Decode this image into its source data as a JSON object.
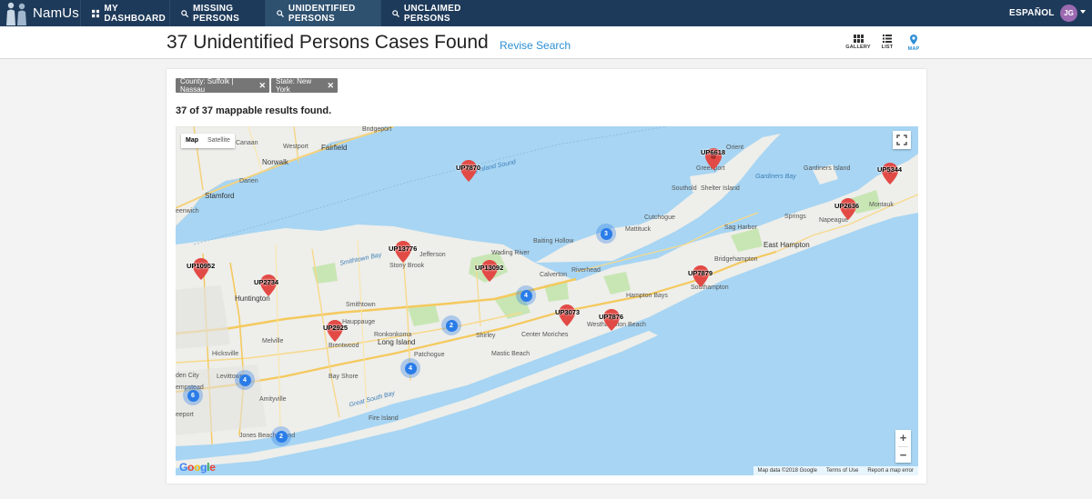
{
  "nav": {
    "logo": "NamUs",
    "items": [
      {
        "label": "MY DASHBOARD",
        "icon": "dashboard-grid-icon"
      },
      {
        "label": "MISSING PERSONS",
        "icon": "search-icon"
      },
      {
        "label": "UNIDENTIFIED PERSONS",
        "icon": "search-icon",
        "active": true
      },
      {
        "label": "UNCLAIMED PERSONS",
        "icon": "search-icon"
      }
    ],
    "language": "ESPAÑOL",
    "avatar_initials": "JG"
  },
  "header": {
    "title": "37 Unidentified Persons Cases Found",
    "revise_label": "Revise Search",
    "views": [
      {
        "label": "GALLERY",
        "icon": "gallery-grid-icon"
      },
      {
        "label": "LIST",
        "icon": "list-icon"
      },
      {
        "label": "MAP",
        "icon": "map-pin-icon",
        "active": true
      }
    ]
  },
  "filters": [
    {
      "label": "County: Suffolk | Nassau"
    },
    {
      "label": "State: New York"
    }
  ],
  "results_text": "37 of 37 mappable results found.",
  "map": {
    "type_tabs": [
      "Map",
      "Satellite"
    ],
    "zoom_in": "+",
    "zoom_out": "−",
    "attribution": [
      "Map data ©2018 Google",
      "Terms of Use",
      "Report a map error"
    ],
    "google_logo": "Google",
    "pins": [
      "UP7870",
      "UP6618",
      "UP5344",
      "UP2636",
      "UP13776",
      "UP10952",
      "UP2734",
      "UP13092",
      "UP7879",
      "UP2925",
      "UP3073",
      "UP7876"
    ],
    "clusters": [
      "3",
      "4",
      "2",
      "4",
      "4",
      "6",
      "2"
    ],
    "places": [
      "Bridgeport",
      "Westport",
      "Fairfield",
      "Canaan",
      "Norwalk",
      "Darien",
      "Stamford",
      "eenwich",
      "Orient",
      "Greenport",
      "Southold",
      "Shelter Island",
      "Gardiners Bay",
      "Gardiners Island",
      "Montauk",
      "Springs",
      "Napeague",
      "Cutchogue",
      "Mattituck",
      "Sag Harbor",
      "East Hampton",
      "Bridgehampton",
      "Southampton",
      "Hampton Bays",
      "Westhampton Beach",
      "Riverhead",
      "Calverton",
      "Baiting Hollow",
      "Wading River",
      "Long Island Sound",
      "Smithtown Bay",
      "Stony Brook",
      "Jefferson",
      "Huntington",
      "Smithtown",
      "Hauppauge",
      "Brentwood",
      "Ronkonkoma",
      "Long Island",
      "Patchogue",
      "Shirley",
      "Mastic Beach",
      "Center Moriches",
      "Bay Shore",
      "Melville",
      "Hicksville",
      "Levittown",
      "empstead",
      "Amityville",
      "eeport",
      "Jones Beach Island",
      "Fire Island",
      "Great South Bay",
      "den City"
    ]
  }
}
